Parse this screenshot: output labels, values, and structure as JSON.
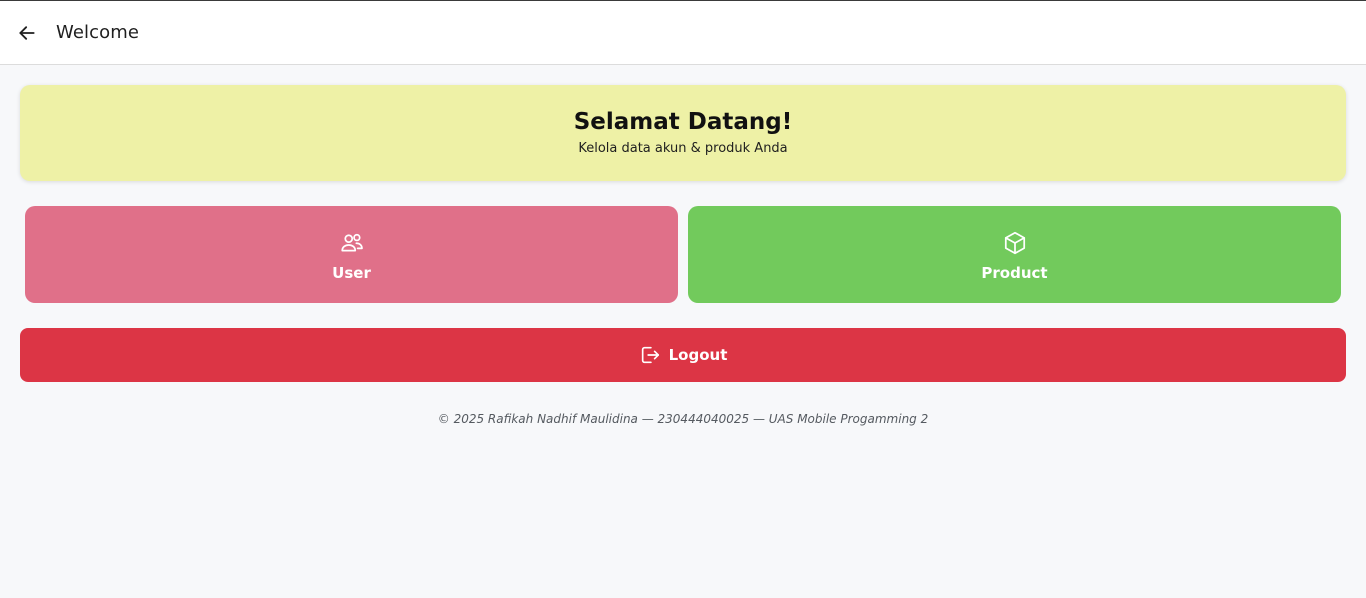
{
  "appbar": {
    "back_icon": "arrow-left-icon",
    "title": "Welcome"
  },
  "banner": {
    "title": "Selamat Datang!",
    "subtitle": "Kelola data akun & produk Anda",
    "background": "#eef1a6"
  },
  "tiles": [
    {
      "label": "User",
      "icon": "users-icon",
      "color": "#e07089"
    },
    {
      "label": "Product",
      "icon": "package-icon",
      "color": "#72ca5c"
    }
  ],
  "logout": {
    "label": "Logout",
    "icon": "logout-icon",
    "color": "#dc3545"
  },
  "footer": {
    "text": "© 2025 Rafikah Nadhif Maulidina — 230444040025 — UAS Mobile Progamming 2"
  }
}
